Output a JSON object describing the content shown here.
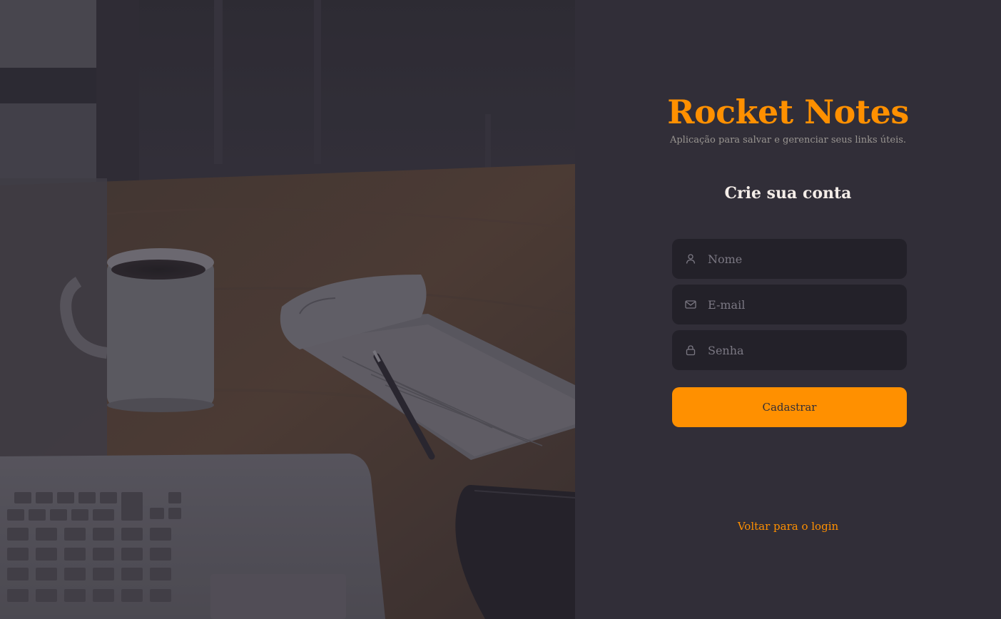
{
  "brand": {
    "title": "Rocket Notes",
    "subtitle": "Aplicação para salvar e gerenciar seus links úteis."
  },
  "form": {
    "heading": "Crie sua conta",
    "fields": [
      {
        "icon": "user-icon",
        "placeholder": "Nome",
        "value": ""
      },
      {
        "icon": "mail-icon",
        "placeholder": "E-mail",
        "value": ""
      },
      {
        "icon": "lock-icon",
        "placeholder": "Senha",
        "value": ""
      }
    ],
    "submit_label": "Cadastrar",
    "back_link_label": "Voltar para o login"
  },
  "colors": {
    "accent": "#ff9000",
    "background": "#312e38",
    "input_background": "#232129",
    "text_primary": "#f4ede8",
    "text_muted": "#999591"
  }
}
